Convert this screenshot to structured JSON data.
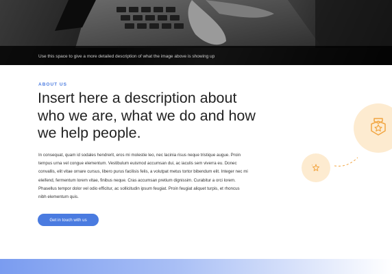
{
  "hero": {
    "caption": "Use this space to give a more detailed description of what the image above is showing up"
  },
  "about": {
    "eyebrow": "ABOUT US",
    "headline": "Insert here a description about who we are, what we do and how we help people.",
    "body": "In consequat, quam id sodales hendrerit, eros mi molestie leo, nec lacinia risus neque tristique augue. Proin tempus urna vel congue elementum. Vestibulum euismod accumsan dui, ac iaculis sem viverra eu. Donec convallis, elit vitae ornare cursus, libero purus facilisis felis, a volutpat metus tortor bibendum elit. Integer nec mi eleifend, fermentum lorem vitae, finibus neque. Cras accumsan pretium dignissim. Curabitur a orci lorem. Phasellus tempor dolor vel odio efficitur, ac sollicitudin ipsum feugiat. Proin feugiat aliquet turpis, et rhoncus nibh elementum quis.",
    "cta_label": "Get in touch with us"
  },
  "icons": {
    "big": "badge-star-icon",
    "small": "sparkle-star-icon"
  },
  "colors": {
    "accent": "#4a7be0",
    "icon_bg": "#fdebd0",
    "icon_stroke": "#f2a541"
  }
}
